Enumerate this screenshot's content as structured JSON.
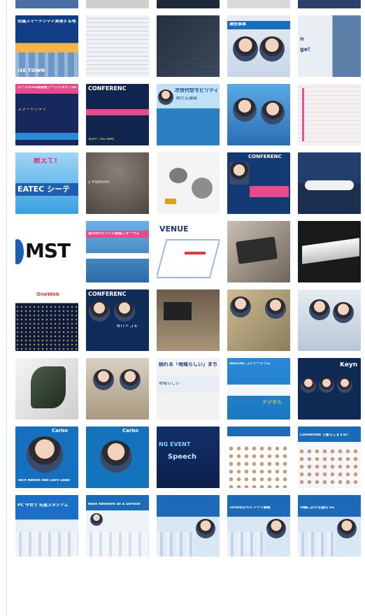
{
  "grid": {
    "thumbnails": [
      {
        "caption": "",
        "sub": "",
        "bg": "#4a6fa5"
      },
      {
        "caption": "",
        "sub": "",
        "bg": "#cfcfcf"
      },
      {
        "caption": "",
        "sub": "",
        "bg": "#1e2a3a"
      },
      {
        "caption": "",
        "sub": "",
        "bg": "#d9d9d9"
      },
      {
        "caption": "",
        "sub": "",
        "bg": "#2c3e6a"
      },
      {
        "caption": "先端スマートシティ実現する地域自治体",
        "sub": "ISE TOWN",
        "bg": "#1d5fa8"
      },
      {
        "caption": "",
        "sub": "",
        "bg": "#eef2f6"
      },
      {
        "caption": "",
        "sub": "",
        "bg": "#26303d"
      },
      {
        "caption": "通信事業",
        "sub": "",
        "bg": "#dde7f2"
      },
      {
        "caption": "n",
        "sub": "ge!",
        "bg": "#e9eef3"
      },
      {
        "caption": "ローカル5G推進者ワークショップ2021",
        "sub": "スマートシティ",
        "bg": "#16285c"
      },
      {
        "caption": "CONFERENC",
        "sub": "3GPP TSG RAN",
        "bg": "#10264f"
      },
      {
        "caption": "次世代空モビリティ",
        "sub": "国土交通省",
        "bg": "#2a7fc1"
      },
      {
        "caption": "",
        "sub": "",
        "bg": "#3b8ed0"
      },
      {
        "caption": "",
        "sub": "",
        "bg": "#f4f0f2"
      },
      {
        "caption": "教えて!",
        "sub": "EATEC シーテ",
        "bg": "#3aa0e0"
      },
      {
        "caption": "",
        "sub": "y Platform",
        "bg": "#6b625c"
      },
      {
        "caption": "",
        "sub": "",
        "bg": "#f4f4f4"
      },
      {
        "caption": "CONFERENC",
        "sub": "",
        "bg": "#133a73"
      },
      {
        "caption": "",
        "sub": "",
        "bg": "#1b3f6e"
      },
      {
        "caption": "MST",
        "sub": "",
        "bg": "#ffffff"
      },
      {
        "caption": "第5世代モバイル推進フォーラム",
        "sub": "",
        "bg": "#2b6aa8"
      },
      {
        "caption": "VENUE",
        "sub": "",
        "bg": "#ffffff"
      },
      {
        "caption": "",
        "sub": "",
        "bg": "#9a8f85"
      },
      {
        "caption": "",
        "sub": "",
        "bg": "#1a1a1a"
      },
      {
        "caption": "OneWeb",
        "sub": "",
        "bg": "#0d1a3a"
      },
      {
        "caption": "CONFERENC",
        "sub": "NTTドコモ",
        "bg": "#0f2c5a"
      },
      {
        "caption": "",
        "sub": "",
        "bg": "#8c7b68"
      },
      {
        "caption": "",
        "sub": "",
        "bg": "#b8a57d"
      },
      {
        "caption": "",
        "sub": "",
        "bg": "#c9d4e0"
      },
      {
        "caption": "",
        "sub": "",
        "bg": "#dedede"
      },
      {
        "caption": "",
        "sub": "",
        "bg": "#c8c0b2"
      },
      {
        "caption": "読れる「地域らしい」まち",
        "sub": "地域らしい",
        "bg": "#f2f2f2"
      },
      {
        "caption": "DIGITAL コンソーシアム",
        "sub": "デジタル",
        "bg": "#1a78c2"
      },
      {
        "caption": "Keyn",
        "sub": "",
        "bg": "#0f2a55"
      },
      {
        "caption": "Carbo",
        "sub": "Tech Nation Net Zero Lead",
        "bg": "#1571c0"
      },
      {
        "caption": "Carbo",
        "sub": "",
        "bg": "#1473bd"
      },
      {
        "caption": "NG EVENT",
        "sub": "Speech",
        "bg": "#0d1f4a"
      },
      {
        "caption": "",
        "sub": "",
        "bg": "#ffffff"
      },
      {
        "caption": "Connected で繋ちしますね!",
        "sub": "",
        "bg": "#f5f7fa"
      },
      {
        "caption": "PC 今世で 先進スタジアム",
        "sub": "",
        "bg": "#1c6fc6"
      },
      {
        "caption": "Next Network as a Service",
        "sub": "",
        "bg": "#eef3f8"
      },
      {
        "caption": "",
        "sub": "",
        "bg": "#1d6ab8"
      },
      {
        "caption": "2030年のモビリティ戦略",
        "sub": "",
        "bg": "#1d6ab8"
      },
      {
        "caption": "沖縄における国内 5G",
        "sub": "",
        "bg": "#1d6ab8"
      }
    ]
  }
}
